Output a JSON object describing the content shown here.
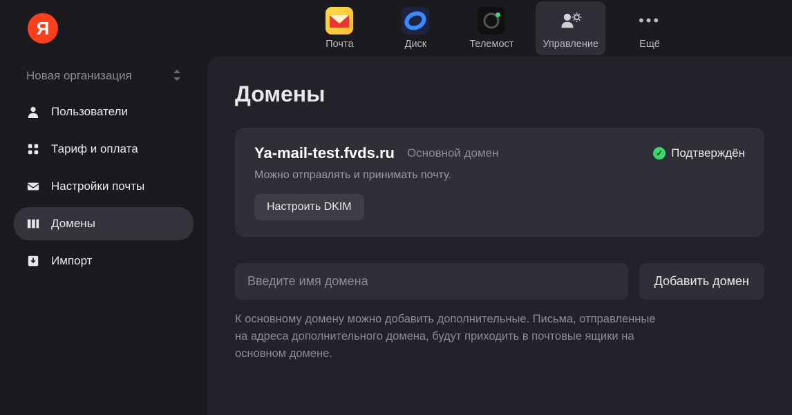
{
  "logo_letter": "Я",
  "topnav": {
    "items": [
      {
        "label": "Почта"
      },
      {
        "label": "Диск"
      },
      {
        "label": "Телемост"
      },
      {
        "label": "Управление"
      },
      {
        "label": "Ещё"
      }
    ]
  },
  "org_selector": {
    "label": "Новая организация"
  },
  "sidebar": {
    "items": [
      {
        "label": "Пользователи"
      },
      {
        "label": "Тариф и оплата"
      },
      {
        "label": "Настройки почты"
      },
      {
        "label": "Домены"
      },
      {
        "label": "Импорт"
      }
    ]
  },
  "page": {
    "title": "Домены"
  },
  "domain_card": {
    "name": "Ya-mail-test.fvds.ru",
    "badge": "Основной домен",
    "status": "Подтверждён",
    "description": "Можно отправлять и принимать почту.",
    "dkim_button": "Настроить DKIM"
  },
  "add_domain": {
    "placeholder": "Введите имя домена",
    "button": "Добавить домен",
    "hint": "К основному домену можно добавить дополнительные. Письма, отправленные на адреса дополнительного домена, будут приходить в почтовые ящики на основном домене."
  },
  "colors": {
    "accent_red": "#fc3f1d",
    "success_green": "#3cd66e",
    "bg_main": "#1a1a1f",
    "bg_panel": "#22222a",
    "bg_card": "#2f2f37"
  }
}
